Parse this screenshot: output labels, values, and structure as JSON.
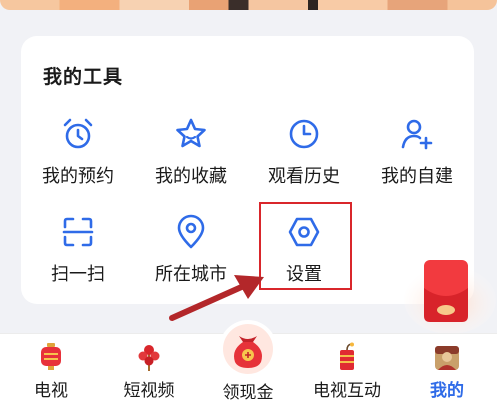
{
  "tools": {
    "title": "我的工具",
    "items": [
      {
        "label": "我的预约",
        "icon": "alarm-clock-icon"
      },
      {
        "label": "我的收藏",
        "icon": "star-icon"
      },
      {
        "label": "观看历史",
        "icon": "clock-icon"
      },
      {
        "label": "我的自建",
        "icon": "add-person-icon"
      },
      {
        "label": "扫一扫",
        "icon": "scan-icon"
      },
      {
        "label": "所在城市",
        "icon": "location-pin-icon"
      },
      {
        "label": "设置",
        "icon": "settings-hexagon-icon"
      }
    ]
  },
  "bottom_nav": {
    "items": [
      {
        "label": "电视",
        "icon": "tv-lantern-icon"
      },
      {
        "label": "短视频",
        "icon": "candied-haws-icon"
      },
      {
        "label": "领现金",
        "icon": "money-bag-icon"
      },
      {
        "label": "电视互动",
        "icon": "firecracker-icon"
      },
      {
        "label": "我的",
        "icon": "profile-avatar-icon",
        "active": true
      }
    ]
  },
  "colors": {
    "accent_blue": "#2f6be8",
    "highlight_red": "#d9262b",
    "background": "#f1f2f6"
  }
}
